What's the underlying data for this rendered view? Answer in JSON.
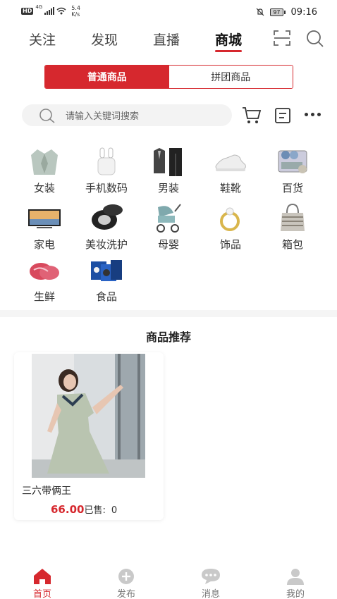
{
  "status_bar": {
    "hd": "HD",
    "network": "4G",
    "speed_value": "5.4",
    "speed_unit": "K/s",
    "battery": "97",
    "time": "09:16"
  },
  "top_nav": {
    "tabs": [
      {
        "label": "关注",
        "active": false
      },
      {
        "label": "发现",
        "active": false
      },
      {
        "label": "直播",
        "active": false
      },
      {
        "label": "商城",
        "active": true
      }
    ]
  },
  "segment": {
    "options": [
      {
        "label": "普通商品",
        "active": true
      },
      {
        "label": "拼团商品",
        "active": false
      }
    ]
  },
  "search": {
    "placeholder": "请输入关键词搜索"
  },
  "categories": [
    {
      "label": "女装",
      "icon": "blazer-icon"
    },
    {
      "label": "手机数码",
      "icon": "earbuds-icon"
    },
    {
      "label": "男装",
      "icon": "suit-icon"
    },
    {
      "label": "鞋靴",
      "icon": "sneaker-icon"
    },
    {
      "label": "百货",
      "icon": "dish-rack-icon"
    },
    {
      "label": "家电",
      "icon": "tv-icon"
    },
    {
      "label": "美妆洗护",
      "icon": "cosmetic-icon"
    },
    {
      "label": "母婴",
      "icon": "stroller-icon"
    },
    {
      "label": "饰品",
      "icon": "ring-icon"
    },
    {
      "label": "箱包",
      "icon": "handbag-icon"
    },
    {
      "label": "生鲜",
      "icon": "meat-icon"
    },
    {
      "label": "食品",
      "icon": "snacks-icon"
    }
  ],
  "recommend": {
    "title": "商品推荐",
    "products": [
      {
        "name": "三六带俩王",
        "price": "66.00",
        "sold_label": "已售:",
        "sold_count": "0"
      }
    ]
  },
  "bottom_nav": {
    "items": [
      {
        "label": "首页",
        "icon": "home-icon",
        "active": true
      },
      {
        "label": "发布",
        "icon": "plus-circle-icon",
        "active": false
      },
      {
        "label": "消息",
        "icon": "chat-icon",
        "active": false
      },
      {
        "label": "我的",
        "icon": "user-icon",
        "active": false
      }
    ]
  },
  "colors": {
    "accent": "#d6282e",
    "search_bg": "#f3f3f3"
  }
}
